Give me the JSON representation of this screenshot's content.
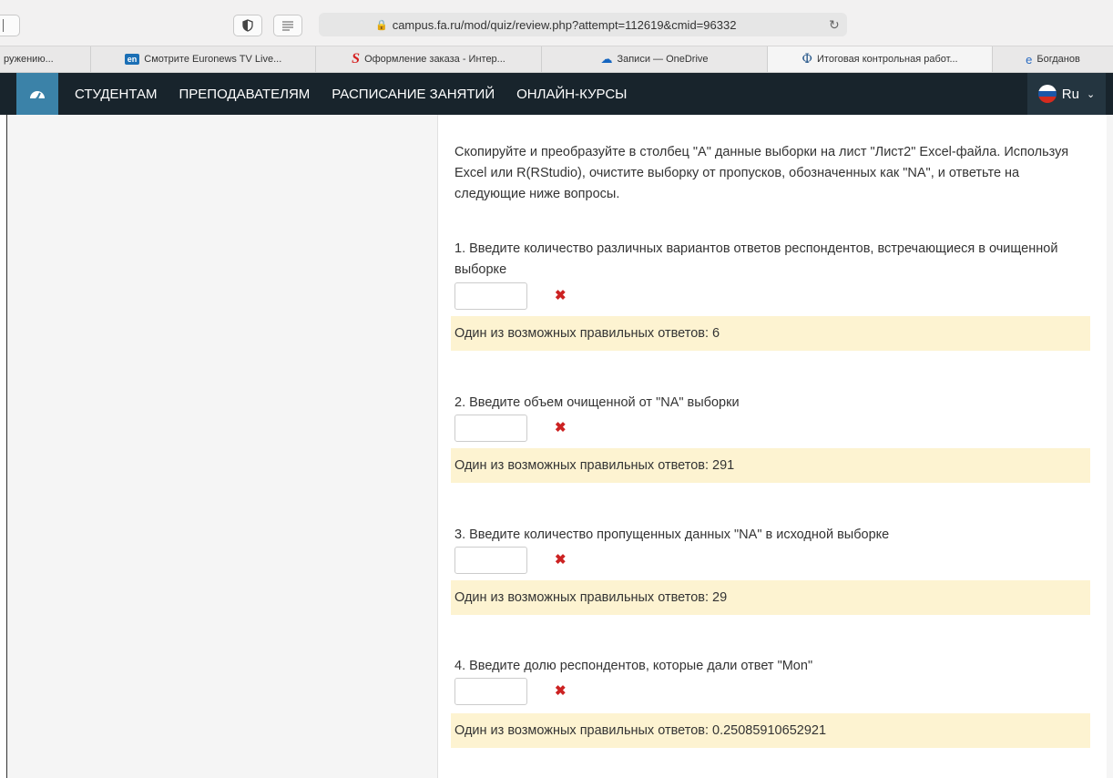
{
  "browser": {
    "url": "campus.fa.ru/mod/quiz/review.php?attempt=112619&cmid=96332",
    "tabs": [
      {
        "label": "ружению...",
        "icon": ""
      },
      {
        "label": "Смотрите Euronews TV Live...",
        "icon": "euronews-icon"
      },
      {
        "label": "Оформление заказа - Интер...",
        "icon": "s-logo-icon"
      },
      {
        "label": "Записи — OneDrive",
        "icon": "onedrive-icon"
      },
      {
        "label": "Итоговая контрольная работ...",
        "icon": "fa-logo-icon",
        "active": true
      },
      {
        "label": "Богданов",
        "icon": "edge-icon"
      }
    ]
  },
  "navbar": {
    "items": [
      "СТУДЕНТАМ",
      "ПРЕПОДАВАТЕЛЯМ",
      "РАСПИСАНИЕ ЗАНЯТИЙ",
      "ОНЛАЙН-КУРСЫ"
    ],
    "language": "Ru"
  },
  "quiz": {
    "intro": "Скопируйте и преобразуйте в столбец \"A\" данные выборки на лист \"Лист2\" Excel-файла. Используя Excel или R(RStudio), очистите выборку от пропусков, обозначенных как \"NA\", и ответьте на следующие ниже вопросы.",
    "questions": [
      {
        "text": "1. Введите количество различных вариантов ответов респондентов, встречающиеся в очищенной выборке",
        "feedback": "Один из возможных правильных ответов: 6"
      },
      {
        "text": "2. Введите объем очищенной от \"NA\" выборки",
        "feedback": "Один из возможных правильных ответов: 291"
      },
      {
        "text": "3. Введите количество пропущенных данных \"NA\" в исходной выборке",
        "feedback": "Один из возможных правильных ответов: 29"
      },
      {
        "text": "4. Введите долю респондентов, которые дали ответ \"Mon\"",
        "feedback": "Один из возможных правильных ответов: 0.25085910652921"
      }
    ]
  },
  "colors": {
    "navbar": "#18242c",
    "dashboard_button": "#3b82a8",
    "feedback_bg": "#fdf3d1",
    "incorrect_mark": "#cc2222"
  }
}
